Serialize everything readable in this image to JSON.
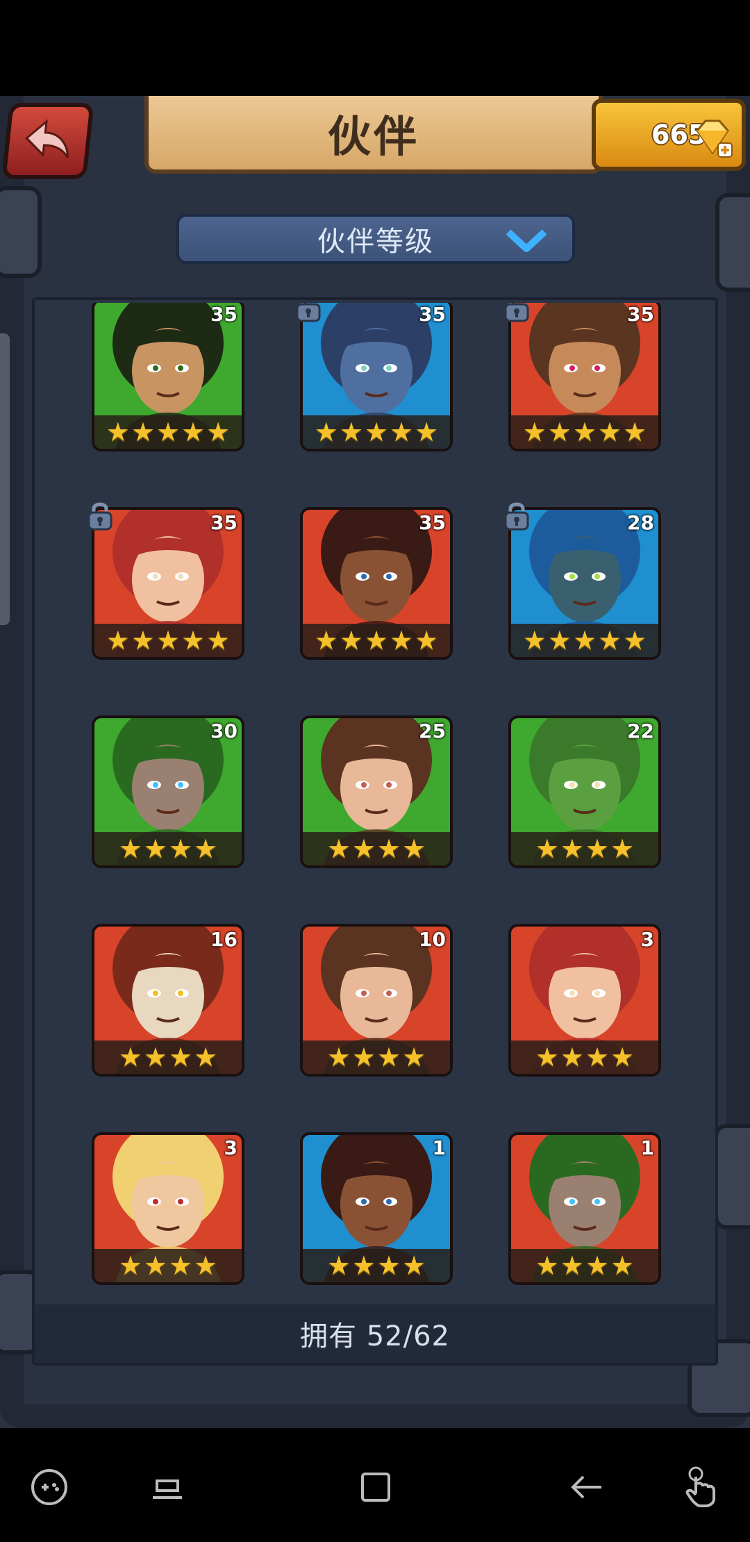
{
  "header": {
    "title": "伙伴",
    "gem_count": "665"
  },
  "sort": {
    "label": "伙伴等级"
  },
  "partners": [
    {
      "level": "35",
      "stars": 5,
      "locked": false,
      "rarity": "green",
      "portrait": "bearded-warrior"
    },
    {
      "level": "35",
      "stars": 5,
      "locked": true,
      "rarity": "blue",
      "portrait": "wolf-beast"
    },
    {
      "level": "35",
      "stars": 5,
      "locked": true,
      "rarity": "red",
      "portrait": "mohawk-brute"
    },
    {
      "level": "35",
      "stars": 5,
      "locked": true,
      "rarity": "red",
      "portrait": "red-hair-woman"
    },
    {
      "level": "35",
      "stars": 5,
      "locked": false,
      "rarity": "red",
      "portrait": "afro-woman"
    },
    {
      "level": "28",
      "stars": 5,
      "locked": true,
      "rarity": "blue",
      "portrait": "blue-hair-man"
    },
    {
      "level": "30",
      "stars": 4,
      "locked": false,
      "rarity": "green",
      "portrait": "hooded-mage"
    },
    {
      "level": "25",
      "stars": 4,
      "locked": false,
      "rarity": "green",
      "portrait": "brown-hair-woman"
    },
    {
      "level": "22",
      "stars": 4,
      "locked": false,
      "rarity": "green",
      "portrait": "crocodile"
    },
    {
      "level": "16",
      "stars": 4,
      "locked": false,
      "rarity": "red",
      "portrait": "skull-totem"
    },
    {
      "level": "10",
      "stars": 4,
      "locked": false,
      "rarity": "red",
      "portrait": "brown-hair-woman"
    },
    {
      "level": "3",
      "stars": 4,
      "locked": false,
      "rarity": "red",
      "portrait": "red-hair-woman"
    },
    {
      "level": "3",
      "stars": 4,
      "locked": false,
      "rarity": "red",
      "portrait": "blonde-woman"
    },
    {
      "level": "1",
      "stars": 4,
      "locked": false,
      "rarity": "blue",
      "portrait": "afro-woman"
    },
    {
      "level": "1",
      "stars": 4,
      "locked": false,
      "rarity": "red",
      "portrait": "hooded-mage"
    }
  ],
  "footer": {
    "owned_text": "拥有 52/62"
  },
  "colors": {
    "green": "#3fa82e",
    "blue": "#1f8fd0",
    "red": "#d8442a",
    "star": "#f5c12b",
    "panel": "#2b3444"
  },
  "icons": {
    "back": "back-arrow-icon",
    "gem": "gem-plus-icon",
    "dropdown": "chevron-down-icon",
    "lock": "lock-icon",
    "nav": [
      "game-tools-icon",
      "recents-icon",
      "home-icon",
      "back-icon",
      "touch-icon"
    ]
  }
}
